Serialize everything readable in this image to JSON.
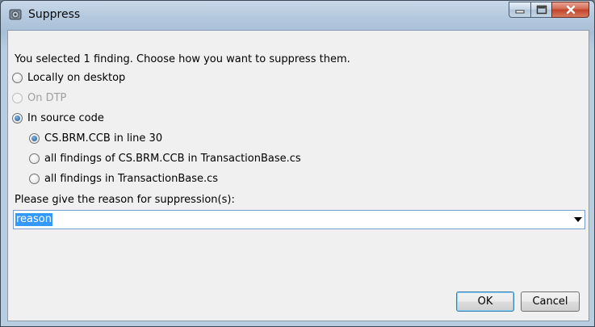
{
  "window": {
    "title": "Suppress"
  },
  "dialog": {
    "prompt": "You selected 1 finding. Choose how you want to suppress them.",
    "options": [
      {
        "label": "Locally on desktop",
        "checked": false,
        "disabled": false
      },
      {
        "label": "On DTP",
        "checked": false,
        "disabled": true
      },
      {
        "label": "In source code",
        "checked": true,
        "disabled": false
      }
    ],
    "suboptions": [
      {
        "label": "CS.BRM.CCB in line 30",
        "checked": true
      },
      {
        "label": "all findings of CS.BRM.CCB in TransactionBase.cs",
        "checked": false
      },
      {
        "label": "all findings in TransactionBase.cs",
        "checked": false
      }
    ],
    "reason_label": "Please give the reason for suppression(s):",
    "reason_value": "reason"
  },
  "buttons": {
    "ok": "OK",
    "cancel": "Cancel"
  },
  "icons": {
    "app": "parasoft-app-icon",
    "minimize": "minimize-icon",
    "maximize": "maximize-icon",
    "close": "close-icon"
  }
}
